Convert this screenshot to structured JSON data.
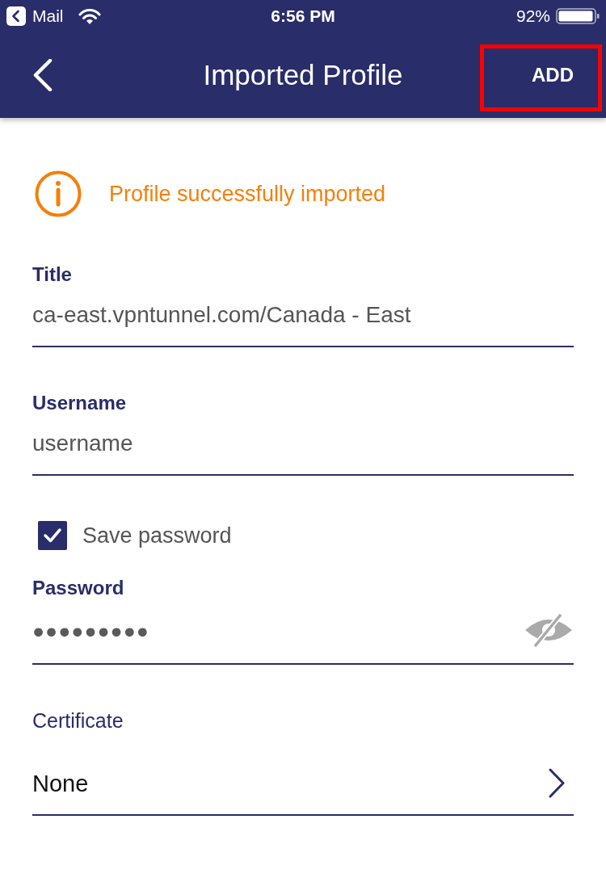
{
  "status_bar": {
    "back_app": "Mail",
    "time": "6:56 PM",
    "battery": "92%"
  },
  "nav_bar": {
    "title": "Imported Profile",
    "action": {
      "label": "ADD",
      "highlighted": true
    }
  },
  "notice": {
    "text": "Profile successfully imported"
  },
  "fields": [
    {
      "kind": "text",
      "label": "Title",
      "value": "ca-east.vpntunnel.com/Canada - East"
    },
    {
      "kind": "text",
      "label": "Username",
      "value": "username"
    },
    {
      "kind": "checkbox",
      "label": "Save password",
      "checked": true
    },
    {
      "kind": "password",
      "label": "Password",
      "value": "●●●●●●●●●",
      "revealed": false
    },
    {
      "kind": "select",
      "label": "Certificate",
      "value": "None"
    }
  ]
}
